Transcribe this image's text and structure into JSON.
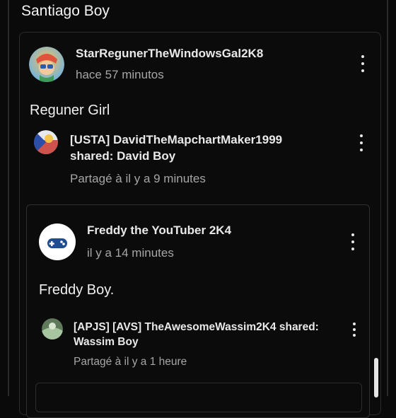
{
  "header": {
    "title": "Santiago Boy"
  },
  "post": {
    "author": "StarRegunerTheWindowsGal2K8",
    "time": "hace 57 minutos",
    "text": "Reguner Girl",
    "share": {
      "author_line1": "[USTA] DavidTheMapchartMaker1999",
      "author_line2": "shared: David Boy",
      "time": "Partagé à il y a 9 minutes"
    },
    "inner": {
      "author": "Freddy the YouTuber 2K4",
      "time": "il y a 14 minutes",
      "text": "Freddy Boy.",
      "share": {
        "author_line1": "[APJS] [AVS] TheAwesomeWassim2K4 shared:",
        "author_line2": "Wassim Boy",
        "time": "Partagé à il y a 1 heure"
      }
    }
  },
  "icons": {
    "more": "more-vert-icon",
    "controller": "gamepad-icon"
  },
  "colors": {
    "background": "#0a0a0a",
    "text": "#f1f1f1",
    "secondary_text": "#a6a6a6",
    "border": "#2c2c2c"
  }
}
